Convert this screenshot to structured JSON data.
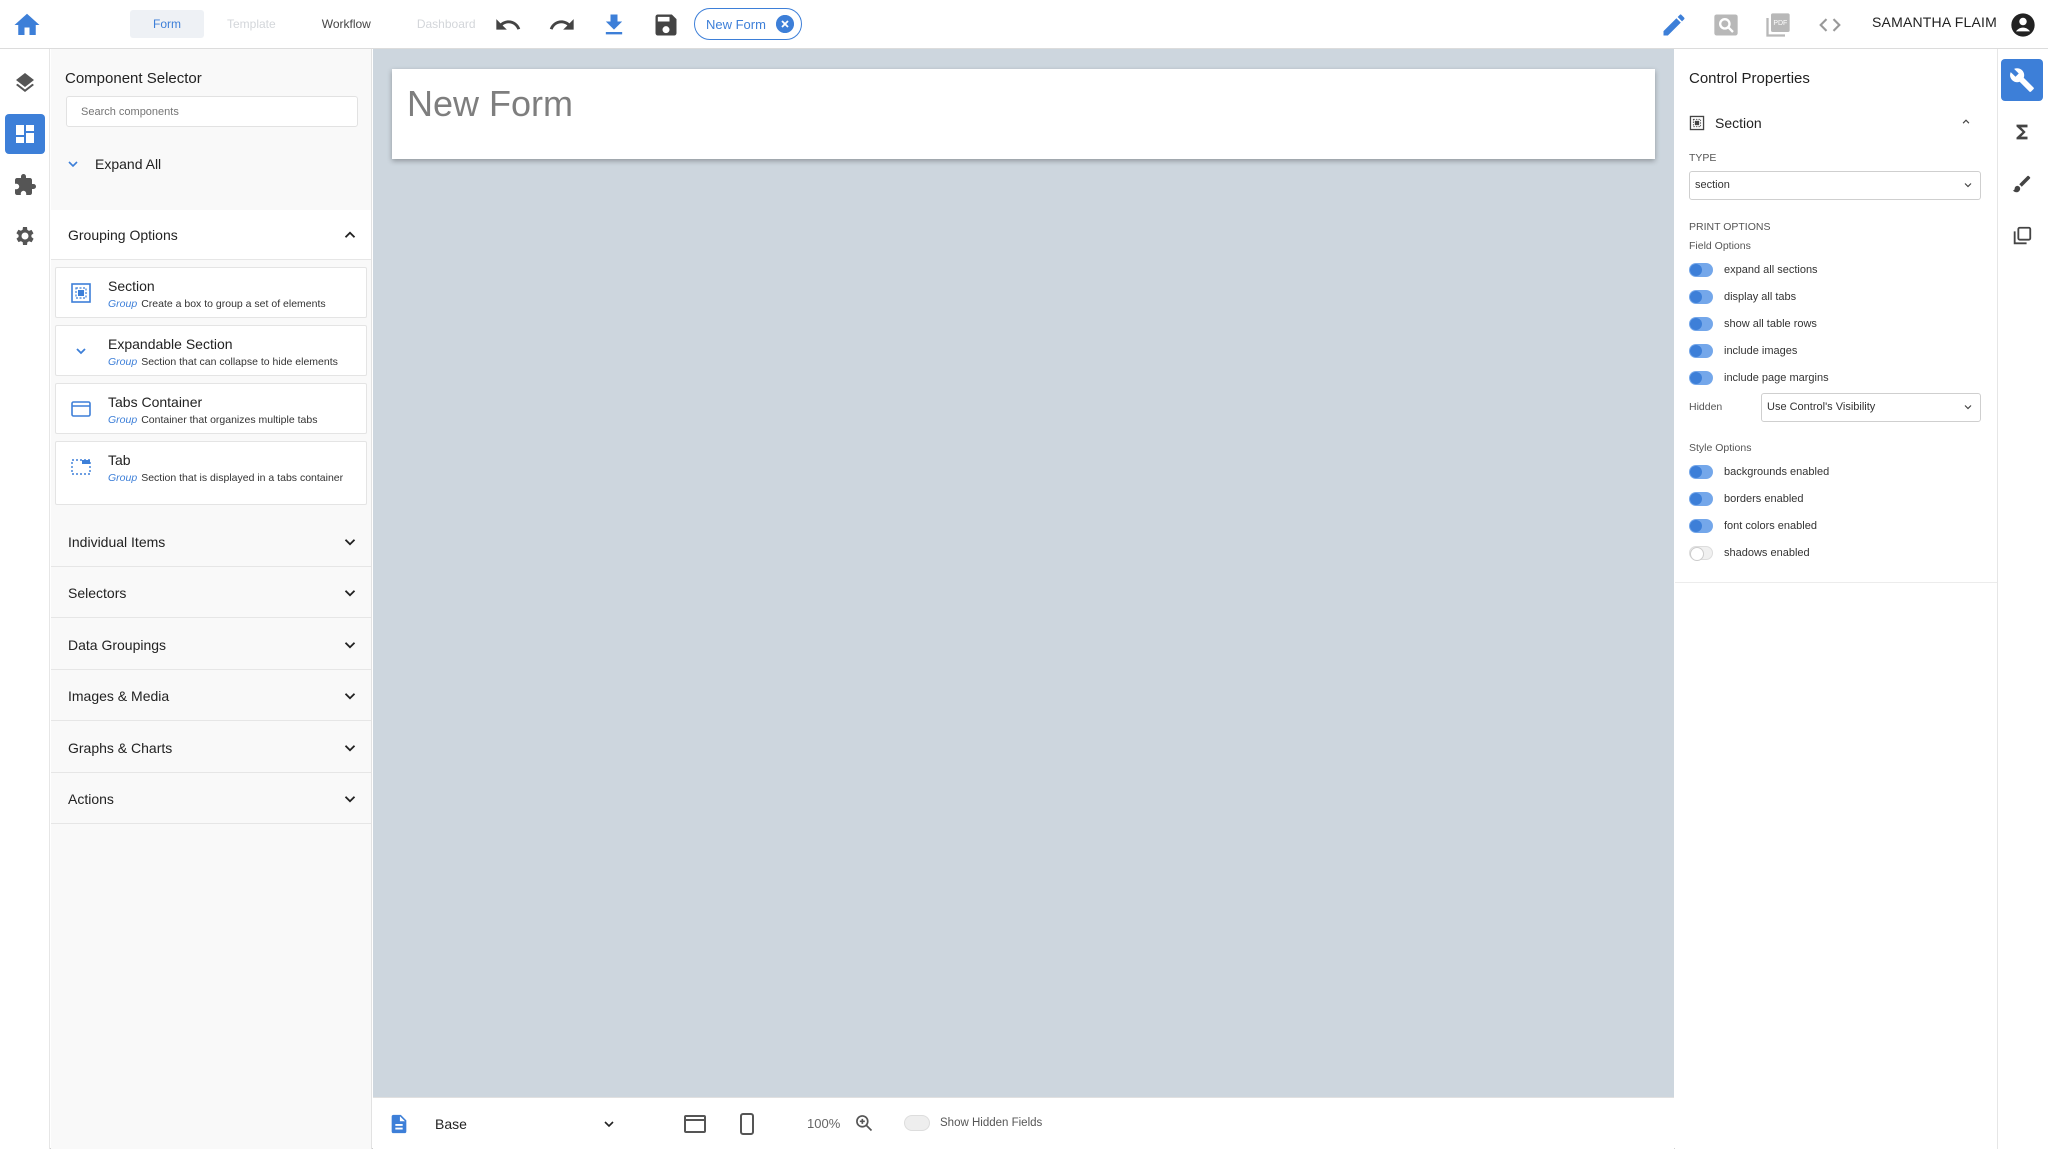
{
  "topbar": {
    "tabs": [
      {
        "label": "Form",
        "state": "active"
      },
      {
        "label": "Template",
        "state": "disabled"
      },
      {
        "label": "Workflow",
        "state": "normal"
      },
      {
        "label": "Dashboard",
        "state": "disabled"
      }
    ],
    "tools": [
      "undo-icon",
      "redo-icon",
      "download-icon",
      "save-icon"
    ],
    "open_form_chip": "New Form",
    "right_tools": [
      "pencil-icon",
      "search-icon",
      "pdf-icon",
      "code-icon"
    ],
    "user_name": "SAMANTHA FLAIM"
  },
  "left_rail": [
    "layers-icon",
    "dashboard-icon",
    "puzzle-icon",
    "gear-icon"
  ],
  "component_selector": {
    "title": "Component Selector",
    "search_placeholder": "Search components",
    "expand_all": "Expand All",
    "grouping": {
      "label": "Grouping Options",
      "items": [
        {
          "name": "Section",
          "group": "Group",
          "desc": "Create a box to group a set of elements"
        },
        {
          "name": "Expandable Section",
          "group": "Group",
          "desc": "Section that can collapse to hide elements"
        },
        {
          "name": "Tabs Container",
          "group": "Group",
          "desc": "Container that organizes multiple tabs"
        },
        {
          "name": "Tab",
          "group": "Group",
          "desc": "Section that is displayed in a tabs container"
        }
      ]
    },
    "categories": [
      "Individual Items",
      "Selectors",
      "Data Groupings",
      "Images & Media",
      "Graphs & Charts",
      "Actions"
    ]
  },
  "canvas": {
    "form_title": "New Form"
  },
  "bottombar": {
    "layout_select": "Base",
    "zoom": "100%",
    "show_hidden_label": "Show Hidden Fields",
    "show_hidden_on": false
  },
  "properties": {
    "title": "Control Properties",
    "section_label": "Section",
    "type_label": "TYPE",
    "type_value": "section",
    "print_options_label": "PRINT OPTIONS",
    "field_options_label": "Field Options",
    "field_options": [
      {
        "label": "expand all sections",
        "on": true
      },
      {
        "label": "display all tabs",
        "on": true
      },
      {
        "label": "show all table rows",
        "on": true
      },
      {
        "label": "include images",
        "on": true
      },
      {
        "label": "include page margins",
        "on": true
      }
    ],
    "hidden_label": "Hidden",
    "hidden_value": "Use Control's Visibility",
    "style_options_label": "Style Options",
    "style_options": [
      {
        "label": "backgrounds enabled",
        "on": true
      },
      {
        "label": "borders enabled",
        "on": true
      },
      {
        "label": "font colors enabled",
        "on": true
      },
      {
        "label": "shadows enabled",
        "on": false
      }
    ]
  },
  "right_rail": [
    "wrench-icon",
    "sigma-icon",
    "brush-icon",
    "copy-icon"
  ],
  "colors": {
    "accent": "#3d7fd8",
    "canvas": "#cdd6de"
  }
}
